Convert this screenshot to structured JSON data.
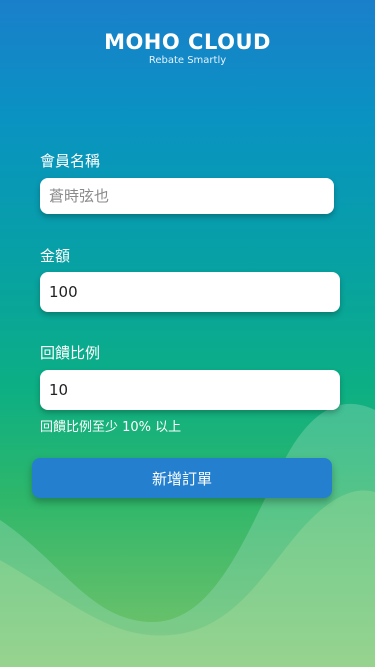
{
  "brand": {
    "title": "MOHO CLOUD",
    "tagline": "Rebate Smartly"
  },
  "form": {
    "member_name": {
      "label": "會員名稱",
      "value": "",
      "placeholder": "蒼時弦也"
    },
    "amount": {
      "label": "金額",
      "value": "100"
    },
    "rebate_ratio": {
      "label": "回饋比例",
      "value": "10",
      "hint": "回饋比例至少 10% 以上"
    },
    "submit_label": "新增訂單"
  },
  "colors": {
    "gradient_top": "#1a7fcb",
    "gradient_bottom": "#7cc46a",
    "button": "#2480cf",
    "field_background": "#ffffff"
  }
}
